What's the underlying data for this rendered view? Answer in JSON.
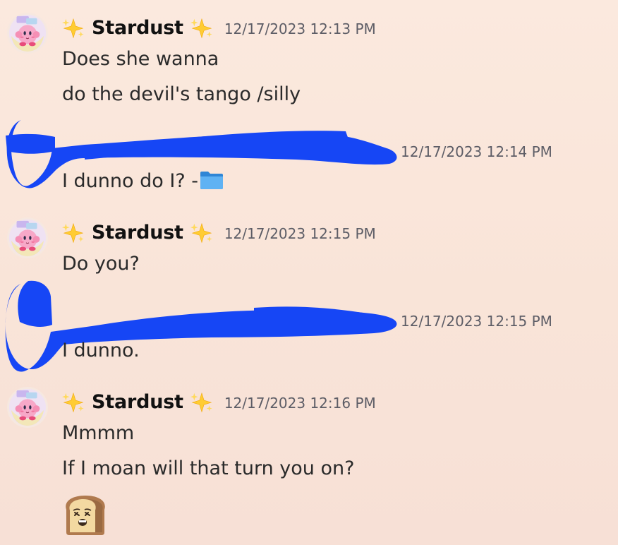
{
  "messages": [
    {
      "author": "Stardust",
      "author_prefix_icon": "sparkles-icon",
      "author_suffix_icon": "sparkles-icon",
      "timestamp": "12/17/2023 12:13 PM",
      "lines": [
        "Does she wanna",
        "do the devil's tango /silly"
      ]
    },
    {
      "author": "",
      "author_redacted": true,
      "timestamp": "12/17/2023 12:14 PM",
      "lines": [
        "I dunno do I? -"
      ],
      "trailing_icon": "file-folder-icon"
    },
    {
      "author": "Stardust",
      "author_prefix_icon": "sparkles-icon",
      "author_suffix_icon": "sparkles-icon",
      "timestamp": "12/17/2023 12:15 PM",
      "lines": [
        "Do you?"
      ]
    },
    {
      "author": "",
      "author_redacted": true,
      "timestamp": "12/17/2023 12:15 PM",
      "lines": [
        "I dunno."
      ]
    },
    {
      "author": "Stardust",
      "author_prefix_icon": "sparkles-icon",
      "author_suffix_icon": "sparkles-icon",
      "timestamp": "12/17/2023 12:16 PM",
      "lines": [
        "Mmmm",
        "If I moan will that turn you on?"
      ],
      "emoji": "bread-toast-emoji"
    }
  ],
  "colors": {
    "background": "#fbe9de",
    "redaction": "#1646f5",
    "username": "#111111",
    "timestamp": "#5d5d66",
    "message_text": "#2a2a2a"
  }
}
